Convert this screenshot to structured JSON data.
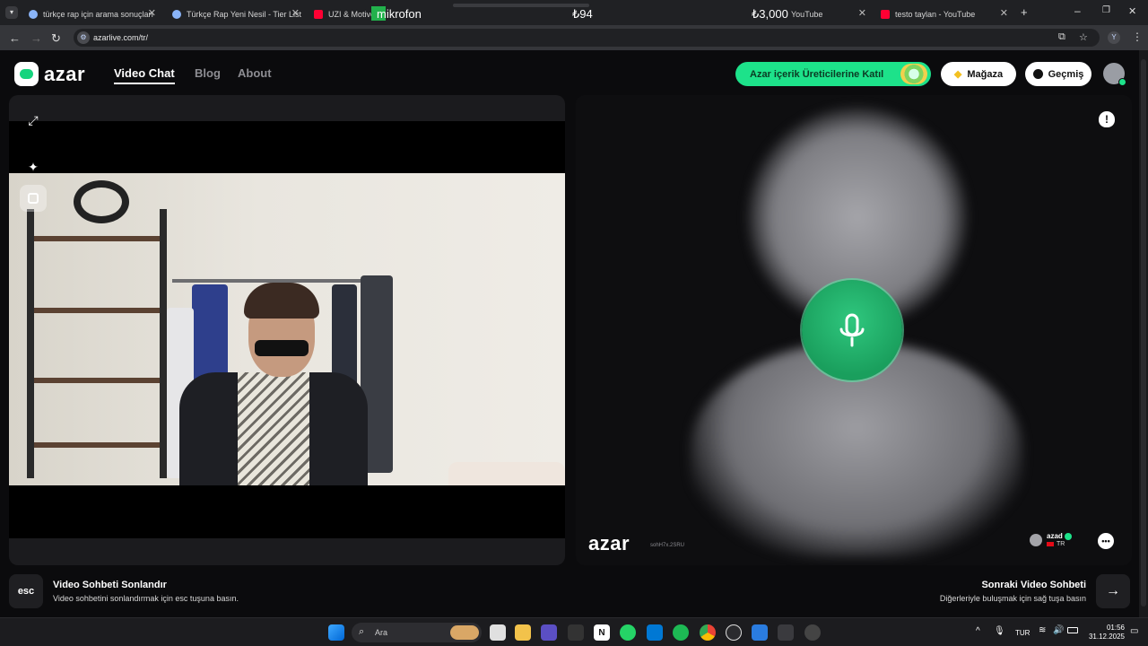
{
  "browser": {
    "tabs": [
      {
        "title": "türkçe rap için arama sonuçları",
        "fav_color": "#8ab4f8"
      },
      {
        "title": "Türkçe Rap Yeni Nesil - Tier List",
        "fav_color": "#8ab4f8"
      },
      {
        "title": "UZI & Motive",
        "fav_color": "#ff0033"
      },
      {
        "title": "YouTube",
        "fav_color": "#ff0033"
      },
      {
        "title": "testo taylan - YouTube",
        "fav_color": "#ff0033"
      }
    ],
    "overlay_labels": [
      "mikrofon",
      "₺94",
      "₺3,000"
    ],
    "url": "azarlive.com/tr/",
    "profile_initial": "Y"
  },
  "header": {
    "logo_text": "azar",
    "nav": [
      "Video Chat",
      "Blog",
      "About"
    ],
    "creator_cta": "Azar içerik Üreticilerine Katıl",
    "shop_label": "Mağaza",
    "history_label": "Geçmiş"
  },
  "remote": {
    "watermark": "azar",
    "watermark_id": "sohH7x.2SRU",
    "peer_name": "azad",
    "peer_country": "TR",
    "report_symbol": "!"
  },
  "actions": {
    "esc_key": "esc",
    "end_title": "Video Sohbeti Sonlandır",
    "end_desc": "Video sohbetini sonlandırmak için esc tuşuna basın.",
    "next_title": "Sonraki Video Sohbeti",
    "next_desc": "Diğerleriyle buluşmak için sağ tuşa basın"
  },
  "taskbar": {
    "search_placeholder": "Ara",
    "language": "TUR",
    "time": "01:56",
    "date": "31.12.2025"
  },
  "colors": {
    "brand_green": "#1de28a",
    "mic_green": "#1a9f5d"
  }
}
